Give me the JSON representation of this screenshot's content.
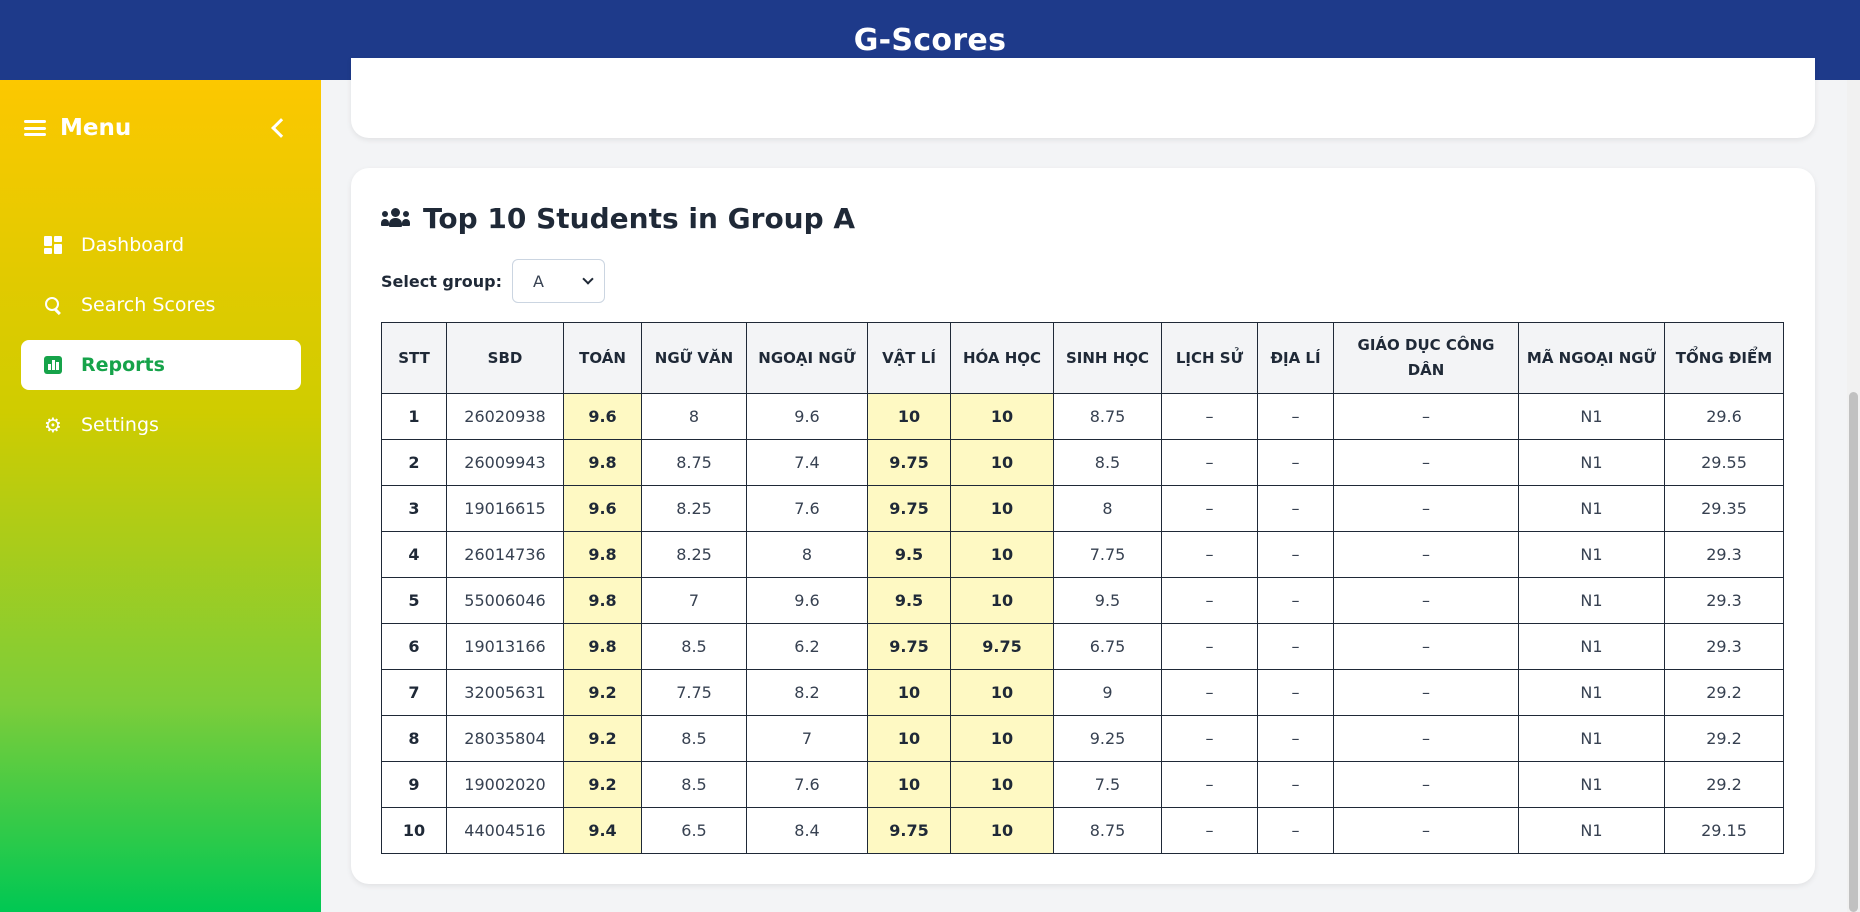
{
  "app": {
    "title": "G-Scores"
  },
  "sidebar": {
    "menu_label": "Menu",
    "items": [
      {
        "label": "Dashboard",
        "icon": "dashboard-icon",
        "active": false
      },
      {
        "label": "Search Scores",
        "icon": "search-icon",
        "active": false
      },
      {
        "label": "Reports",
        "icon": "bar-chart-icon",
        "active": true
      },
      {
        "label": "Settings",
        "icon": "gear-icon",
        "active": false
      }
    ]
  },
  "report": {
    "title": "Top 10 Students in Group A",
    "select_label": "Select group:",
    "selected_group": "A",
    "columns": [
      "STT",
      "SBD",
      "TOÁN",
      "NGỮ VĂN",
      "NGOẠI NGỮ",
      "VẬT LÍ",
      "HÓA HỌC",
      "SINH HỌC",
      "LỊCH SỬ",
      "ĐỊA LÍ",
      "GIÁO DỤC CÔNG DÂN",
      "MÃ NGOẠI NGỮ",
      "TỔNG ĐIỂM"
    ],
    "highlight_color": "#fef9c3",
    "rows": [
      [
        "1",
        "26020938",
        "9.6",
        "8",
        "9.6",
        "10",
        "10",
        "8.75",
        "–",
        "–",
        "–",
        "N1",
        "29.6"
      ],
      [
        "2",
        "26009943",
        "9.8",
        "8.75",
        "7.4",
        "9.75",
        "10",
        "8.5",
        "–",
        "–",
        "–",
        "N1",
        "29.55"
      ],
      [
        "3",
        "19016615",
        "9.6",
        "8.25",
        "7.6",
        "9.75",
        "10",
        "8",
        "–",
        "–",
        "–",
        "N1",
        "29.35"
      ],
      [
        "4",
        "26014736",
        "9.8",
        "8.25",
        "8",
        "9.5",
        "10",
        "7.75",
        "–",
        "–",
        "–",
        "N1",
        "29.3"
      ],
      [
        "5",
        "55006046",
        "9.8",
        "7",
        "9.6",
        "9.5",
        "10",
        "9.5",
        "–",
        "–",
        "–",
        "N1",
        "29.3"
      ],
      [
        "6",
        "19013166",
        "9.8",
        "8.5",
        "6.2",
        "9.75",
        "9.75",
        "6.75",
        "–",
        "–",
        "–",
        "N1",
        "29.3"
      ],
      [
        "7",
        "32005631",
        "9.2",
        "7.75",
        "8.2",
        "10",
        "10",
        "9",
        "–",
        "–",
        "–",
        "N1",
        "29.2"
      ],
      [
        "8",
        "28035804",
        "9.2",
        "8.5",
        "7",
        "10",
        "10",
        "9.25",
        "–",
        "–",
        "–",
        "N1",
        "29.2"
      ],
      [
        "9",
        "19002020",
        "9.2",
        "8.5",
        "7.6",
        "10",
        "10",
        "7.5",
        "–",
        "–",
        "–",
        "N1",
        "29.2"
      ],
      [
        "10",
        "44004516",
        "9.4",
        "6.5",
        "8.4",
        "9.75",
        "10",
        "8.75",
        "–",
        "–",
        "–",
        "N1",
        "29.15"
      ]
    ]
  },
  "theme": {
    "header_bg": "#1e3a8a",
    "sidebar_gradient": [
      "#fcc800",
      "#00c853"
    ],
    "active_text": "#16a34a"
  }
}
